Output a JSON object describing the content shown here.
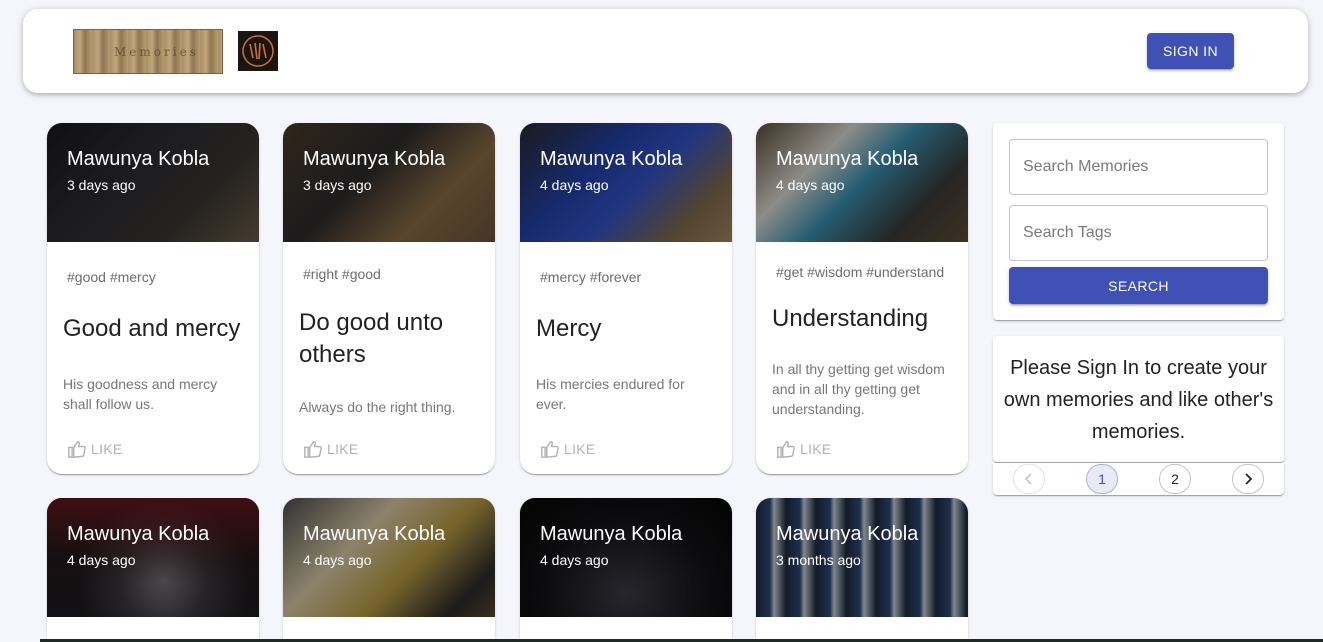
{
  "header": {
    "logo_text": "Memories",
    "signin_label": "SIGN IN"
  },
  "posts": [
    {
      "author": "Mawunya Kobla",
      "time": "3 days ago",
      "tags": "#good #mercy",
      "title": "Good and mercy",
      "message": "His goodness and mercy shall follow us.",
      "like_label": "LIKE"
    },
    {
      "author": "Mawunya Kobla",
      "time": "3 days ago",
      "tags": "#right #good",
      "title": "Do good unto others",
      "message": "Always do the right thing.",
      "like_label": "LIKE"
    },
    {
      "author": "Mawunya Kobla",
      "time": "4 days ago",
      "tags": "#mercy #forever",
      "title": "Mercy",
      "message": "His mercies endured for ever.",
      "like_label": "LIKE"
    },
    {
      "author": "Mawunya Kobla",
      "time": "4 days ago",
      "tags": "#get #wisdom #understand",
      "title": "Understanding",
      "message": "In all thy getting get wisdom and in all thy getting get understanding.",
      "like_label": "LIKE"
    },
    {
      "author": "Mawunya Kobla",
      "time": "4 days ago"
    },
    {
      "author": "Mawunya Kobla",
      "time": "4 days ago"
    },
    {
      "author": "Mawunya Kobla",
      "time": "4 days ago"
    },
    {
      "author": "Mawunya Kobla",
      "time": "3 months ago"
    }
  ],
  "search": {
    "memories_placeholder": "Search Memories",
    "tags_placeholder": "Search Tags",
    "button_label": "SEARCH"
  },
  "signin_prompt": "Please Sign In to create your own memories and like other's memories.",
  "pagination": {
    "pages": [
      "1",
      "2"
    ],
    "current_page": 1
  },
  "colors": {
    "primary": "#3f51b5",
    "background": "#f5f6fb"
  }
}
